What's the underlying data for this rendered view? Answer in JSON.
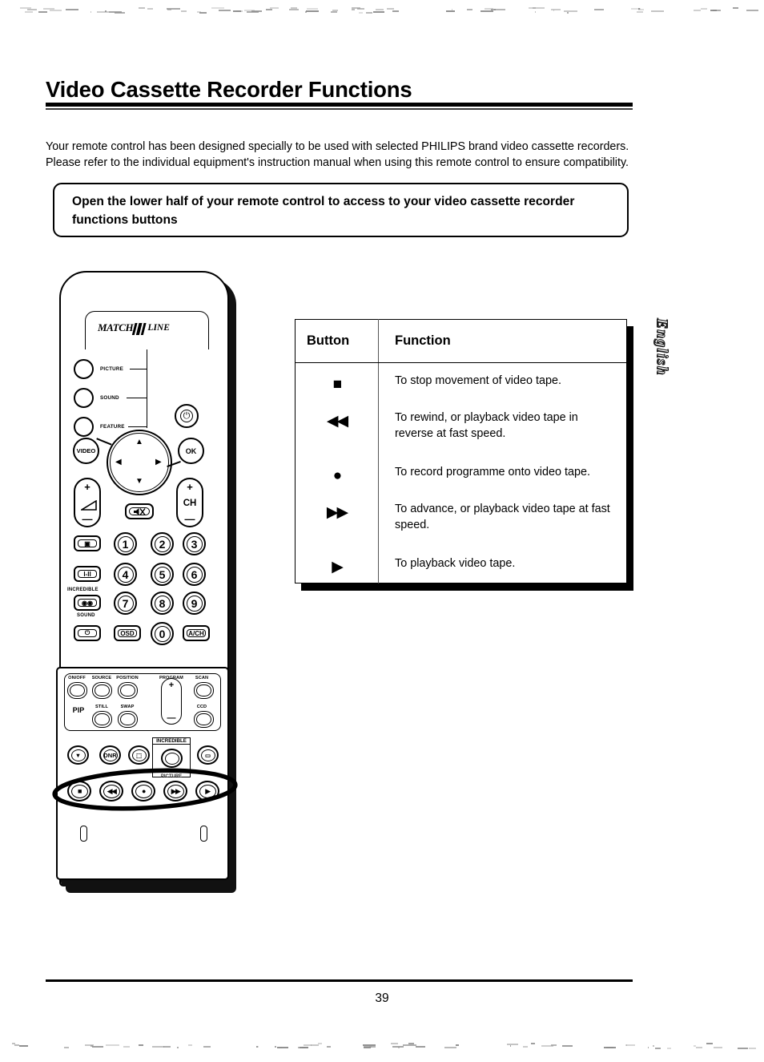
{
  "document": {
    "title": "Video Cassette Recorder Functions",
    "intro": "Your remote control has been designed specially to be used with selected PHILIPS brand video cassette recorders. Please refer to the individual equipment's instruction manual when using this remote control to ensure compatibility.",
    "callout": "Open the lower half of your remote control to access to your video cassette recorder functions buttons",
    "language_tab": "English",
    "page_number": "39"
  },
  "table": {
    "headers": [
      "Button",
      "Function"
    ],
    "rows": [
      {
        "symbol": "■",
        "symbol_name": "stop-icon",
        "function": "To stop movement of video tape."
      },
      {
        "symbol": "◀◀",
        "symbol_name": "rewind-icon",
        "function": "To rewind, or playback video tape in reverse at fast speed."
      },
      {
        "symbol": "●",
        "symbol_name": "record-icon",
        "function": "To record programme onto video tape."
      },
      {
        "symbol": "▶▶",
        "symbol_name": "fast-forward-icon",
        "function": "To advance, or playback video tape at fast speed."
      },
      {
        "symbol": "▶",
        "symbol_name": "play-icon",
        "function": "To playback video tape."
      }
    ]
  },
  "remote": {
    "brand_logo": {
      "match": "MATCH",
      "line": "LINE"
    },
    "mode_buttons": [
      {
        "label": "PICTURE"
      },
      {
        "label": "SOUND"
      },
      {
        "label": "FEATURE"
      }
    ],
    "power_glyph": "⏻",
    "video_label": "VIDEO",
    "ok_label": "OK",
    "dpad": {
      "up": "▲",
      "down": "▼",
      "left": "◀",
      "right": "▶"
    },
    "volume_rocker": {
      "plus": "+",
      "minus": "—"
    },
    "channel_rocker": {
      "plus": "+",
      "label": "CH",
      "minus": "—"
    },
    "mute_glyph": "🔇",
    "side_buttons": [
      {
        "label": "▣",
        "name": "screen-format-button"
      },
      {
        "label": "I-II",
        "name": "dual-sound-button"
      },
      {
        "label": "◉◉",
        "name": "incredible-sound-button",
        "caption_top": "INCREDIBLE",
        "caption_bottom": "SOUND"
      },
      {
        "label": "⏻",
        "name": "standby-button"
      }
    ],
    "keypad": [
      "1",
      "2",
      "3",
      "4",
      "5",
      "6",
      "7",
      "8",
      "9"
    ],
    "keypad_bottom": [
      {
        "label": "OSD",
        "name": "osd-button"
      },
      {
        "label": "0",
        "name": "key-0"
      },
      {
        "label": "A/CH",
        "name": "alternate-channel-button"
      }
    ],
    "pip_section": {
      "group_label": "PIP",
      "row1": [
        "ON/OFF",
        "SOURCE",
        "POSITION",
        "PROGRAM",
        "SCAN"
      ],
      "row2": [
        "STILL",
        "SWAP",
        "CCD"
      ],
      "program_rocker": {
        "plus": "+",
        "minus": "—"
      }
    },
    "feature_row": [
      {
        "label": "▼",
        "name": "sleep-button"
      },
      {
        "label": "DNR",
        "name": "dnr-button"
      },
      {
        "label": "⬚",
        "name": "active-control-button"
      },
      {
        "label": "",
        "name": "incredible-picture-button",
        "caption_top": "INCREDIBLE",
        "caption_bottom": "PICTURE"
      },
      {
        "label": "▭",
        "name": "teletext-button"
      }
    ],
    "transport_row": [
      {
        "label": "■",
        "name": "vcr-stop-button"
      },
      {
        "label": "◀◀",
        "name": "vcr-rewind-button"
      },
      {
        "label": "●",
        "name": "vcr-record-button"
      },
      {
        "label": "▶▶",
        "name": "vcr-fast-forward-button"
      },
      {
        "label": "▶",
        "name": "vcr-play-button"
      }
    ]
  },
  "colors": {
    "ink": "#000000",
    "paper": "#ffffff",
    "shadow": "#111111"
  }
}
